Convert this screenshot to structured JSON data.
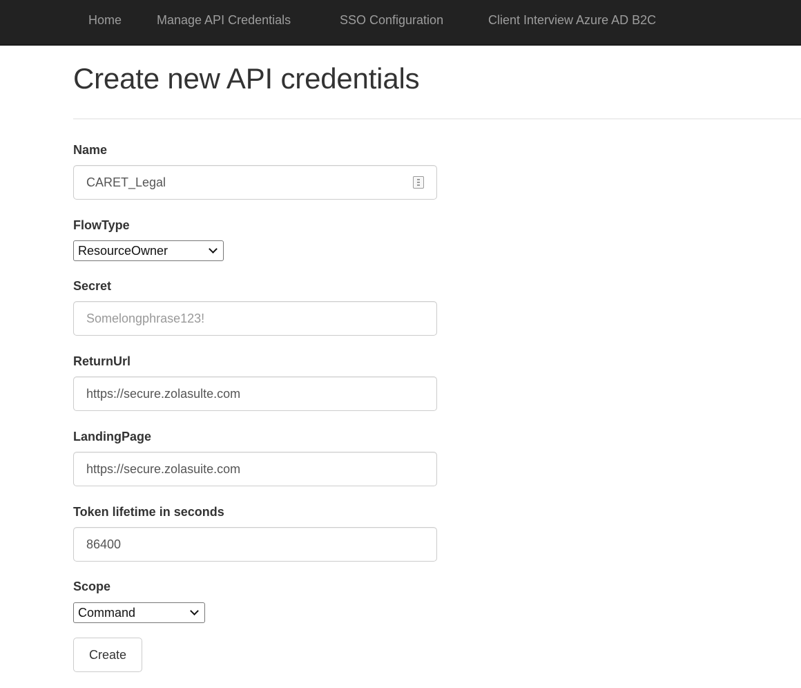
{
  "nav": {
    "items": [
      {
        "label": "Home"
      },
      {
        "label": "Manage API Credentials"
      },
      {
        "label": "SSO Configuration"
      },
      {
        "label": "Client Interview Azure AD B2C"
      }
    ]
  },
  "page": {
    "title": "Create new API credentials"
  },
  "form": {
    "name": {
      "label": "Name",
      "value": "CARET_Legal",
      "icon": "password-manager-icon"
    },
    "flow_type": {
      "label": "FlowType",
      "selected": "ResourceOwner"
    },
    "secret": {
      "label": "Secret",
      "placeholder": "Somelongphrase123!"
    },
    "return_url": {
      "label": "ReturnUrl",
      "value": "https://secure.zolasulte.com"
    },
    "landing_page": {
      "label": "LandingPage",
      "value": "https://secure.zolasuite.com"
    },
    "token_lifetime": {
      "label": "Token lifetime in seconds",
      "value": "86400"
    },
    "scope": {
      "label": "Scope",
      "selected": "Command"
    },
    "submit_label": "Create"
  },
  "colors": {
    "navbar_bg": "#222222",
    "nav_text": "#9d9d9d",
    "text": "#333333",
    "input_border": "#cccccc"
  }
}
